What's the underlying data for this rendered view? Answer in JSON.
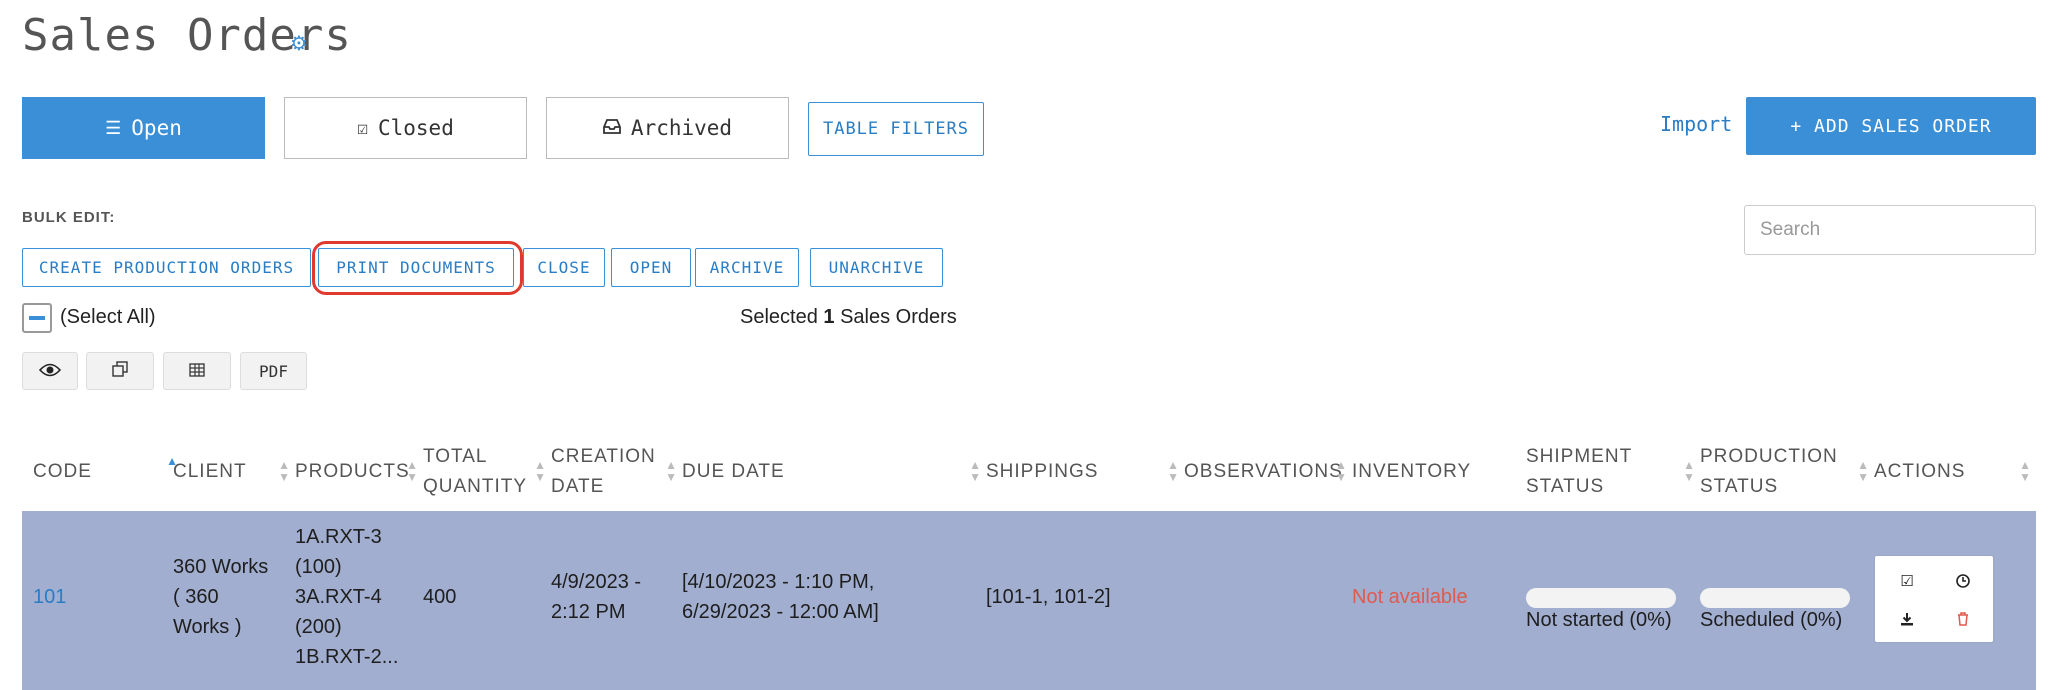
{
  "page": {
    "title": "Sales Orders",
    "settings_icon": "gear-icon"
  },
  "state_tabs": [
    {
      "label": "Open",
      "icon": "list-icon",
      "active": true
    },
    {
      "label": "Closed",
      "icon": "check-square-icon",
      "active": false
    },
    {
      "label": "Archived",
      "icon": "inbox-icon",
      "active": false
    }
  ],
  "table_filters_label": "TABLE FILTERS",
  "import_label": "Import",
  "add_sales_order_label": "+ ADD SALES ORDER",
  "bulk_edit": {
    "label": "BULK EDIT:",
    "buttons": [
      "CREATE PRODUCTION ORDERS",
      "PRINT DOCUMENTS",
      "CLOSE",
      "OPEN",
      "ARCHIVE",
      "UNARCHIVE"
    ]
  },
  "search": {
    "placeholder": "Search",
    "value": ""
  },
  "selection": {
    "select_all_label": "(Select All)",
    "prefix": "Selected",
    "count": "1",
    "suffix": "Sales Orders"
  },
  "toolbar": {
    "view_icon": "eye-icon",
    "copy_icon": "copy-icon",
    "table_icon": "table-icon",
    "pdf_label": "PDF"
  },
  "table": {
    "columns": [
      {
        "line1": "CODE",
        "line2": "",
        "sort": "asc"
      },
      {
        "line1": "CLIENT",
        "line2": "",
        "sort": "none"
      },
      {
        "line1": "PRODUCTS",
        "line2": "",
        "sort": "none"
      },
      {
        "line1": "TOTAL",
        "line2": "QUANTITY",
        "sort": "none"
      },
      {
        "line1": "CREATION",
        "line2": "DATE",
        "sort": "none"
      },
      {
        "line1": "DUE DATE",
        "line2": "",
        "sort": "none"
      },
      {
        "line1": "SHIPPINGS",
        "line2": "",
        "sort": "none"
      },
      {
        "line1": "OBSERVATIONS",
        "line2": "",
        "sort": "none"
      },
      {
        "line1": "INVENTORY",
        "line2": "",
        "sort": "none"
      },
      {
        "line1": "SHIPMENT",
        "line2": "STATUS",
        "sort": "none"
      },
      {
        "line1": "PRODUCTION",
        "line2": "STATUS",
        "sort": "none"
      },
      {
        "line1": "ACTIONS",
        "line2": "",
        "sort": "none"
      }
    ],
    "rows": [
      {
        "code": "101",
        "client": [
          "360 Works",
          "( 360",
          "Works )"
        ],
        "products": [
          "1A.RXT-3",
          "(100)",
          "3A.RXT-4",
          "(200)",
          "1B.RXT-2..."
        ],
        "total_quantity": "400",
        "creation_date": [
          "4/9/2023 -",
          "2:12 PM"
        ],
        "due_date": [
          "[4/10/2023 - 1:10 PM,",
          "6/29/2023 - 12:00 AM]"
        ],
        "shippings": "[101-1, 101-2]",
        "observations": "",
        "inventory": "Not available",
        "shipment_status": {
          "label": "Not started (0%)",
          "progress": 0
        },
        "production_status": {
          "label": "Scheduled (0%)",
          "progress": 0
        },
        "actions": [
          "check-square-icon",
          "clock-icon",
          "download-icon",
          "trash-icon"
        ]
      }
    ]
  },
  "colors": {
    "accent": "#3a8fd6",
    "selected_row": "#a1aecf",
    "danger": "#e05a4e",
    "highlight_ring": "#e03a2f"
  }
}
